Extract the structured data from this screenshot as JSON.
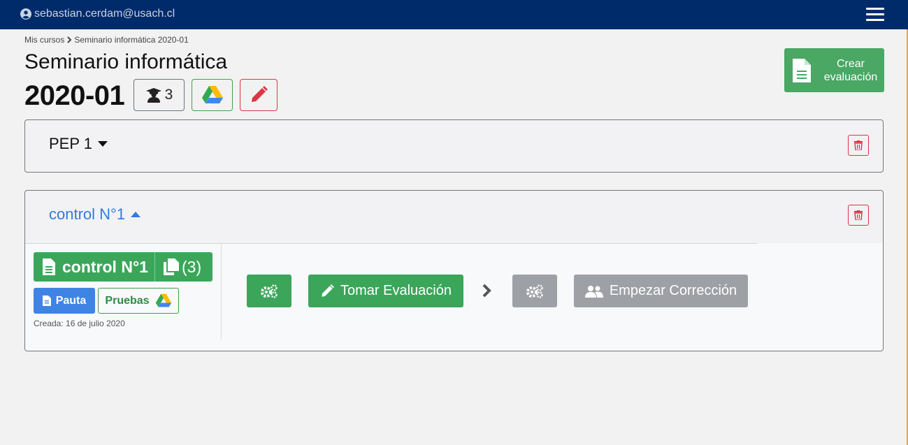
{
  "nav": {
    "user_email": "sebastian.cerdam@usach.cl"
  },
  "breadcrumb": {
    "root": "Mis cursos",
    "current": "Seminario informática 2020-01"
  },
  "course": {
    "title": "Seminario informática",
    "period": "2020-01",
    "students_count": "3"
  },
  "create_button": {
    "label_line1": "Crear",
    "label_line2": "evaluación"
  },
  "evaluations": [
    {
      "title": "PEP 1",
      "expanded": false
    },
    {
      "title": "control N°1",
      "expanded": true,
      "button_label": "control N°1",
      "copies": "(3)",
      "pauta_label": "Pauta",
      "pruebas_label": "Pruebas",
      "created": "Creada: 16 de julio 2020",
      "take_label": "Tomar Evaluación",
      "correct_label": "Empezar Corrección"
    }
  ],
  "colors": {
    "navbar": "#002b6b",
    "success": "#3ba659",
    "primary": "#3f84e5",
    "danger": "#dc3545",
    "disabled": "#9da0a5",
    "link": "#2f7be0"
  }
}
